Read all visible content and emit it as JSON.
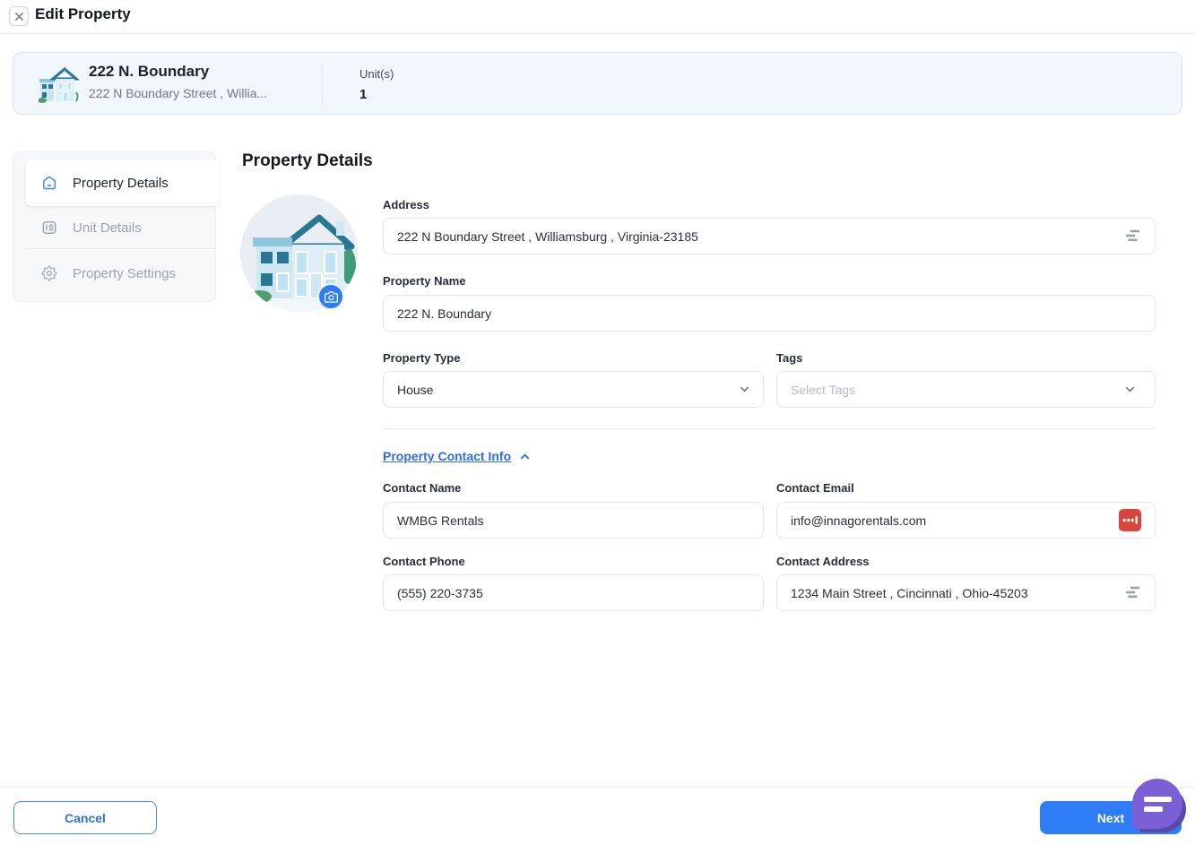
{
  "header": {
    "title": "Edit Property"
  },
  "summary": {
    "name": "222 N. Boundary",
    "address_truncated": "222 N Boundary Street , Willia...",
    "units_label": "Unit(s)",
    "units_value": "1"
  },
  "sidebar": {
    "items": [
      {
        "label": "Property Details",
        "icon": "home-icon",
        "active": true
      },
      {
        "label": "Unit Details",
        "icon": "unit-icon",
        "active": false
      },
      {
        "label": "Property Settings",
        "icon": "gear-icon",
        "active": false
      }
    ]
  },
  "main": {
    "title": "Property Details",
    "contact_section_label": "Property Contact Info",
    "fields": {
      "address": {
        "label": "Address",
        "value": "222 N Boundary Street , Williamsburg , Virginia-23185"
      },
      "property_name": {
        "label": "Property Name",
        "value": "222 N. Boundary"
      },
      "property_type": {
        "label": "Property Type",
        "value": "House"
      },
      "tags": {
        "label": "Tags",
        "placeholder": "Select Tags"
      },
      "contact_name": {
        "label": "Contact Name",
        "value": "WMBG Rentals"
      },
      "contact_email": {
        "label": "Contact Email",
        "value": "info@innagorentals.com"
      },
      "contact_phone": {
        "label": "Contact Phone",
        "value": "(555) 220-3735"
      },
      "contact_address": {
        "label": "Contact Address",
        "value": "1234 Main Street , Cincinnati , Ohio-45203"
      }
    }
  },
  "footer": {
    "cancel_label": "Cancel",
    "next_label": "Next"
  },
  "colors": {
    "accent_blue": "#2e7df6",
    "link_blue": "#2f6bed",
    "chat_purple": "#7b5fd5",
    "extension_red": "#d8453c",
    "summary_bg": "#f2f6fd"
  }
}
